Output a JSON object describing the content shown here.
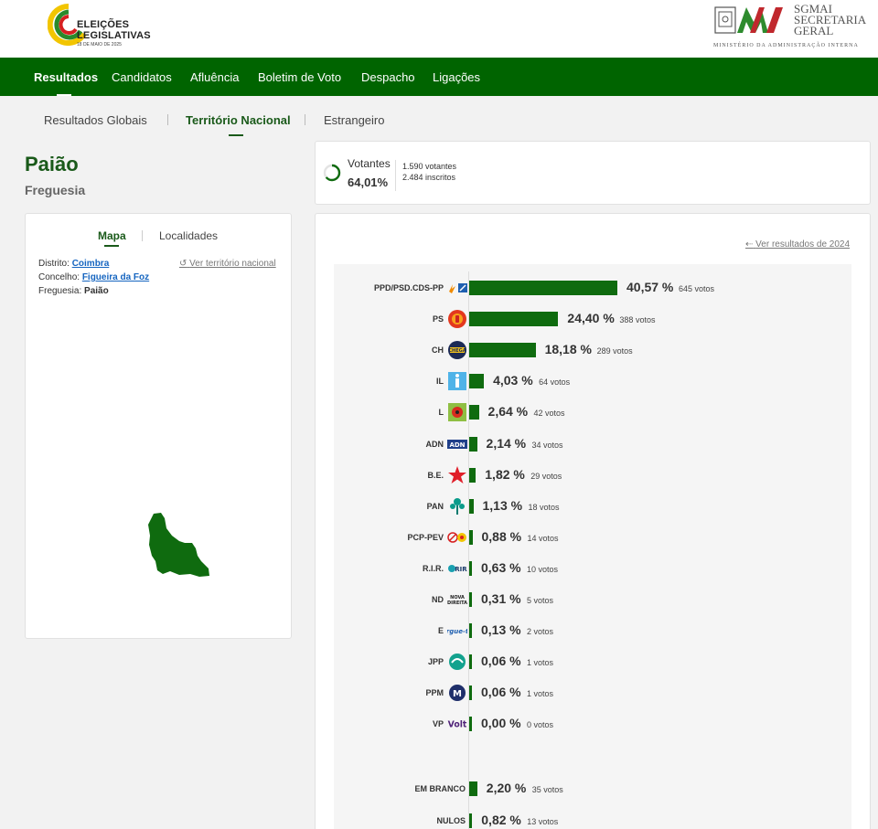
{
  "header": {
    "logo_line1": "ELEIÇÕES",
    "logo_line2": "LEGISLATIVAS",
    "logo_date": "18 DE MAIO DE 2025",
    "sg_line1": "SGMAI",
    "sg_line2": "SECRETARIA",
    "sg_line3": "GERAL",
    "sg_footer": "MINISTÉRIO DA ADMINISTRAÇÃO INTERNA"
  },
  "nav": {
    "items": [
      "Resultados",
      "Candidatos",
      "Afluência",
      "Boletim de Voto",
      "Despacho",
      "Ligações"
    ],
    "active": "Resultados"
  },
  "subnav": {
    "items": [
      "Resultados Globais",
      "Território Nacional",
      "Estrangeiro"
    ],
    "active": "Território Nacional"
  },
  "place": {
    "name": "Paião",
    "type": "Freguesia"
  },
  "map_card": {
    "tabs": [
      "Mapa",
      "Localidades"
    ],
    "active_tab": "Mapa",
    "distrito_label": "Distrito:",
    "distrito": "Coimbra",
    "concelho_label": "Concelho:",
    "concelho": "Figueira da Foz",
    "freguesia_label": "Freguesia:",
    "freguesia": "Paião",
    "ver_nacional": "Ver território nacional"
  },
  "votantes": {
    "label": "Votantes",
    "pct": "64,01%",
    "votantes": "1.590 votantes",
    "inscritos": "2.484 inscritos",
    "fraction": 0.6401
  },
  "results": {
    "ver_2024": "Ver resultados de 2024",
    "parties": [
      {
        "name": "PPD/PSD.CDS-PP",
        "pct": "40,57 %",
        "votes": "645 votos",
        "value": 40.57,
        "logo": "ad-logo"
      },
      {
        "name": "PS",
        "pct": "24,40 %",
        "votes": "388 votos",
        "value": 24.4,
        "logo": "ps-logo"
      },
      {
        "name": "CH",
        "pct": "18,18 %",
        "votes": "289 votos",
        "value": 18.18,
        "logo": "chega-logo"
      },
      {
        "name": "IL",
        "pct": "4,03 %",
        "votes": "64 votos",
        "value": 4.03,
        "logo": "il-logo"
      },
      {
        "name": "L",
        "pct": "2,64 %",
        "votes": "42 votos",
        "value": 2.64,
        "logo": "livre-logo"
      },
      {
        "name": "ADN",
        "pct": "2,14 %",
        "votes": "34 votos",
        "value": 2.14,
        "logo": "adn-logo"
      },
      {
        "name": "B.E.",
        "pct": "1,82 %",
        "votes": "29 votos",
        "value": 1.82,
        "logo": "be-logo"
      },
      {
        "name": "PAN",
        "pct": "1,13 %",
        "votes": "18 votos",
        "value": 1.13,
        "logo": "pan-logo"
      },
      {
        "name": "PCP-PEV",
        "pct": "0,88 %",
        "votes": "14 votos",
        "value": 0.88,
        "logo": "cdu-logo"
      },
      {
        "name": "R.I.R.",
        "pct": "0,63 %",
        "votes": "10 votos",
        "value": 0.63,
        "logo": "rir-logo"
      },
      {
        "name": "ND",
        "pct": "0,31 %",
        "votes": "5 votos",
        "value": 0.31,
        "logo": "nd-logo"
      },
      {
        "name": "E",
        "pct": "0,13 %",
        "votes": "2 votos",
        "value": 0.13,
        "logo": "ergue-te-logo"
      },
      {
        "name": "JPP",
        "pct": "0,06 %",
        "votes": "1 votos",
        "value": 0.06,
        "logo": "jpp-logo"
      },
      {
        "name": "PPM",
        "pct": "0,06 %",
        "votes": "1 votos",
        "value": 0.06,
        "logo": "ppm-logo"
      },
      {
        "name": "VP",
        "pct": "0,00 %",
        "votes": "0 votos",
        "value": 0.0,
        "logo": "volt-logo"
      }
    ],
    "other": [
      {
        "name": "EM BRANCO",
        "pct": "2,20 %",
        "votes": "35 votos",
        "value": 2.2
      },
      {
        "name": "NULOS",
        "pct": "0,82 %",
        "votes": "13 votos",
        "value": 0.82
      }
    ]
  },
  "colors": {
    "brand_green": "#006400",
    "bar_green": "#0f6b0f",
    "link_blue": "#1565c0"
  }
}
